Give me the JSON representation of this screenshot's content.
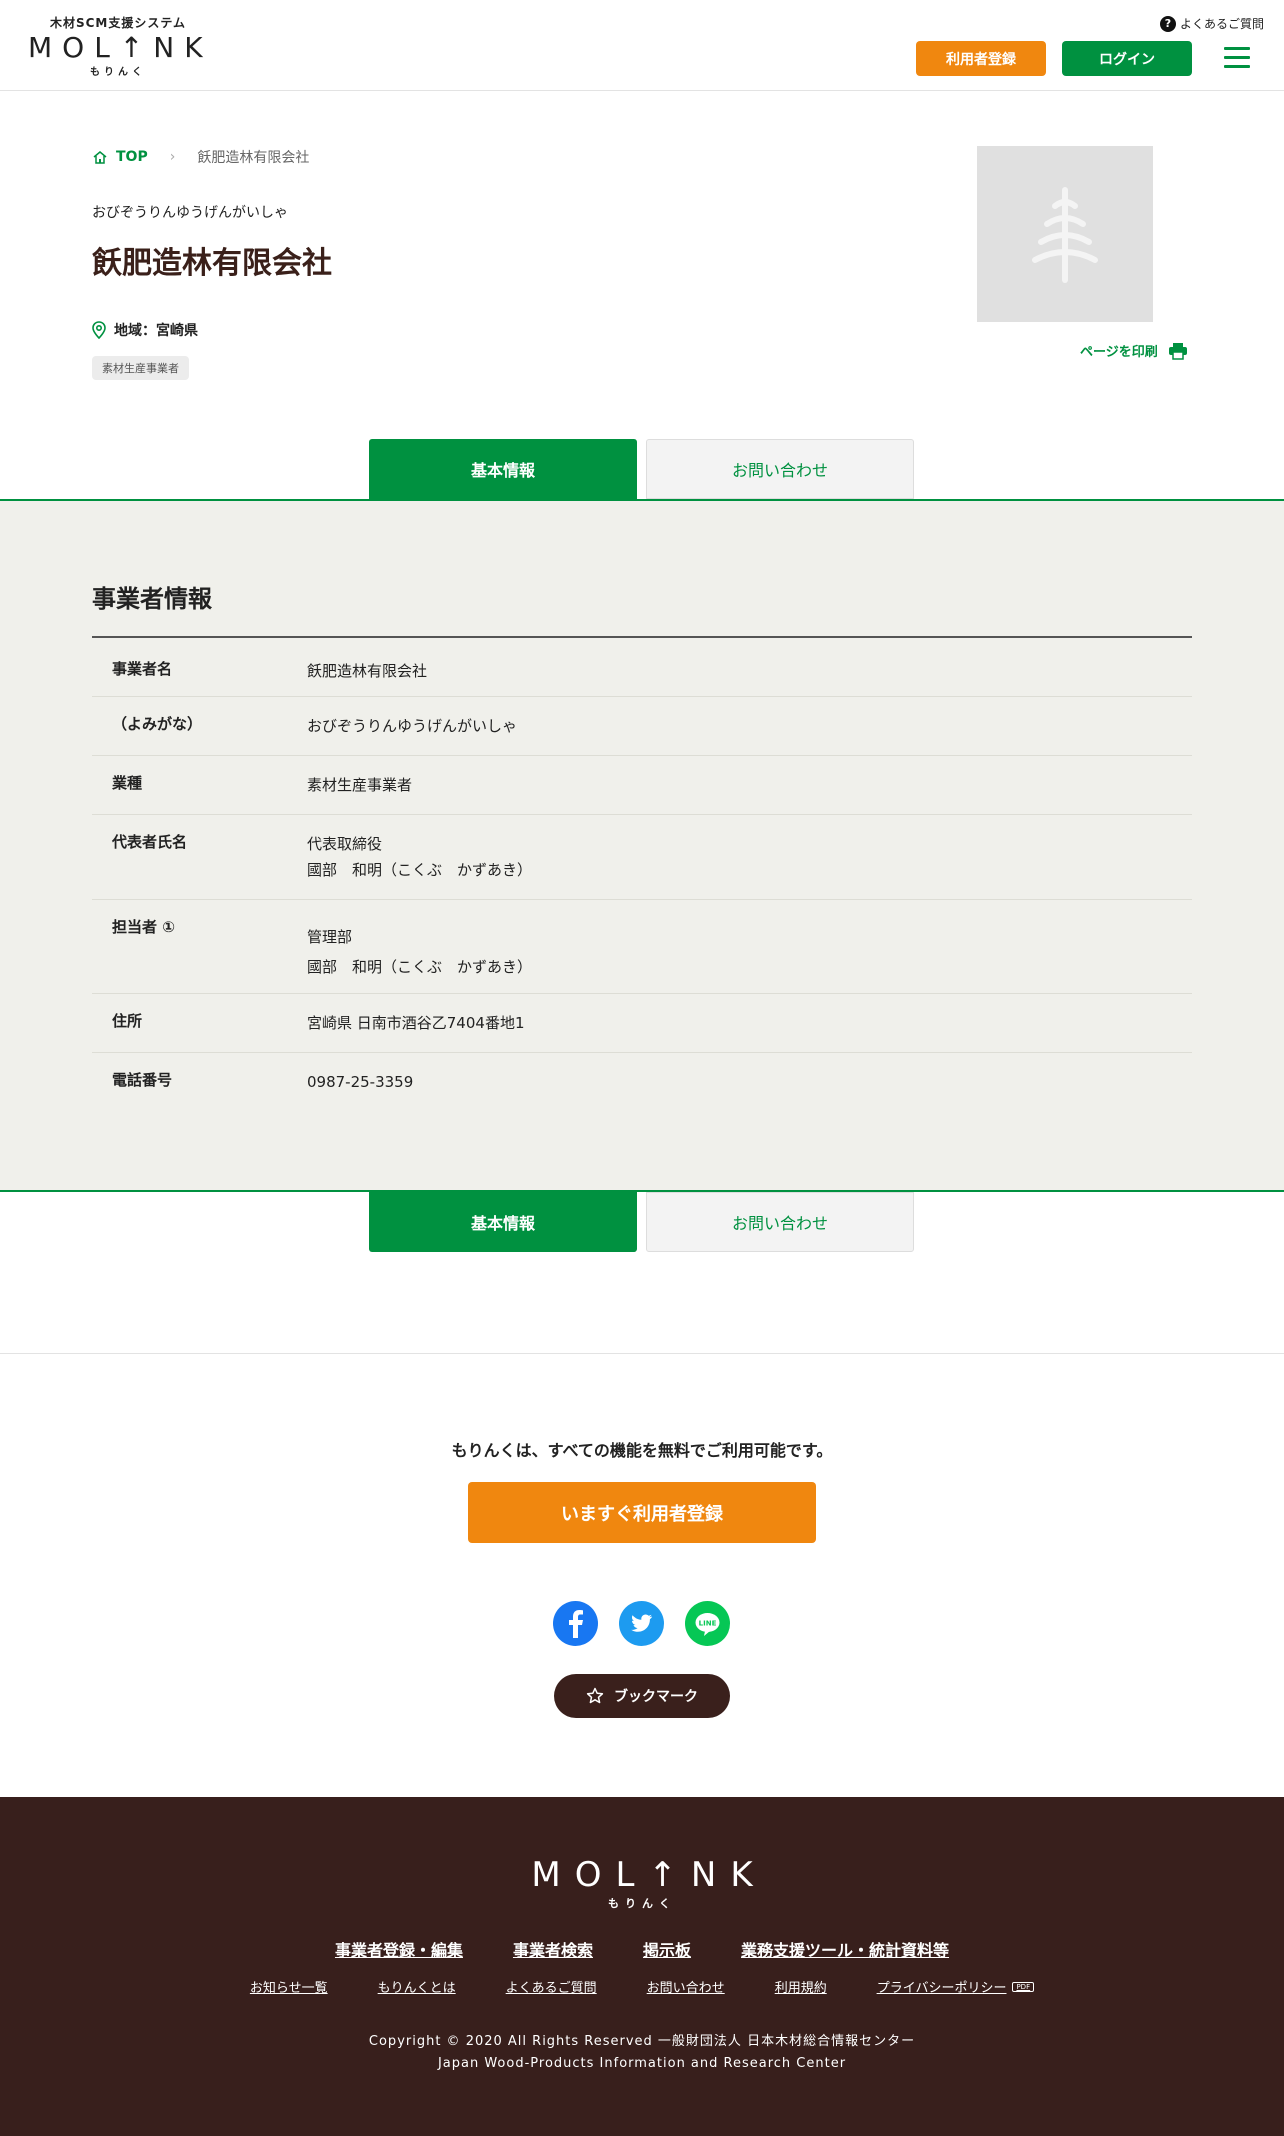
{
  "header": {
    "logo_sub": "木材SCM支援システム",
    "logo_main": "MOL↑NK",
    "logo_kana": "もりんく",
    "faq_label": "よくあるご質問",
    "register_label": "利用者登録",
    "login_label": "ログイン"
  },
  "breadcrumb": {
    "top_label": "TOP",
    "current": "飫肥造林有限会社"
  },
  "company": {
    "kana": "おびぞうりんゆうげんがいしゃ",
    "name": "飫肥造林有限会社",
    "region": "地域：宮崎県",
    "tag": "素材生産事業者"
  },
  "print_label": "ページを印刷",
  "tabs": {
    "basic": "基本情報",
    "contact": "お問い合わせ"
  },
  "info": {
    "title": "事業者情報",
    "rows": [
      {
        "label": "事業者名",
        "lines": [
          "飫肥造林有限会社"
        ]
      },
      {
        "label": "（よみがな）",
        "lines": [
          "おびぞうりんゆうげんがいしゃ"
        ]
      },
      {
        "label": "業種",
        "lines": [
          "素材生産事業者"
        ]
      },
      {
        "label": "代表者氏名",
        "lines": [
          "代表取締役",
          "國部　和明（こくぶ　かずあき）"
        ]
      },
      {
        "label": "担当者 ①",
        "lines": [
          "管理部",
          "國部　和明（こくぶ　かずあき）"
        ]
      },
      {
        "label": "住所",
        "lines": [
          "宮崎県 日南市酒谷乙7404番地1"
        ]
      },
      {
        "label": "電話番号",
        "lines": [
          "0987-25-3359"
        ]
      }
    ]
  },
  "cta": {
    "text": "もりんくは、すべての機能を無料でご利用可能です。",
    "button": "いますぐ利用者登録",
    "bookmark": "ブックマーク"
  },
  "footer": {
    "logo_main": "MOL↑NK",
    "logo_kana": "もりんく",
    "nav_primary": [
      "事業者登録・編集",
      "事業者検索",
      "掲示板",
      "業務支援ツール・統計資料等"
    ],
    "nav_secondary": [
      "お知らせ一覧",
      "もりんくとは",
      "よくあるご質問",
      "お問い合わせ",
      "利用規約",
      "プライバシーポリシー"
    ],
    "pdf_badge": "PDF",
    "copyright": "Copyright © 2020 All Rights Reserved 一般財団法人 日本木材総合情報センター",
    "org_en": "Japan Wood-Products Information and Research Center"
  },
  "colors": {
    "green": "#009140",
    "orange": "#f0870f",
    "brown": "#381f1c",
    "section_bg": "#f0f0eb"
  }
}
